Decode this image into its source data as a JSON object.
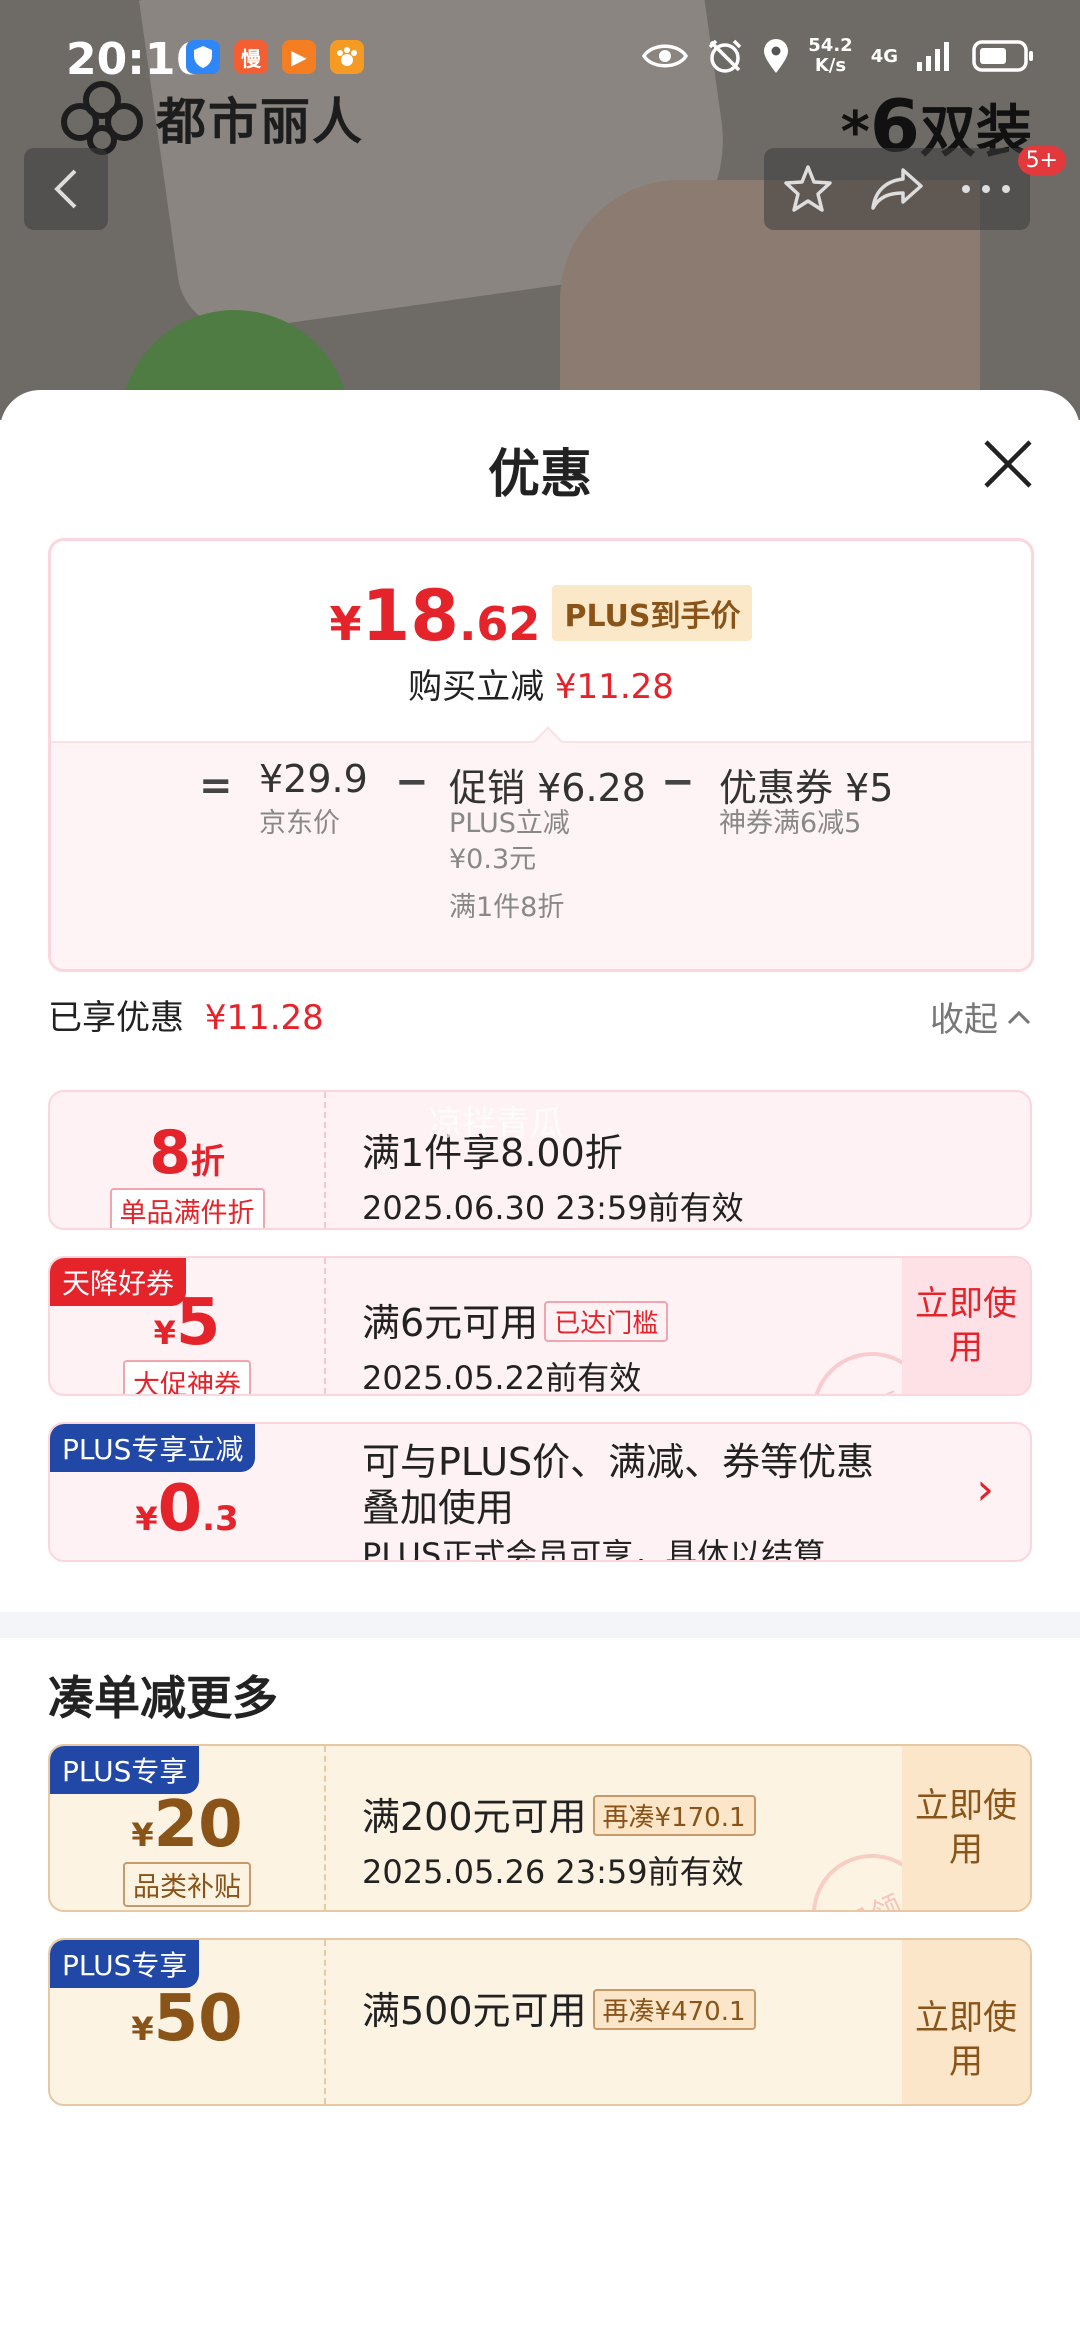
{
  "status_bar": {
    "time": "20:16",
    "speed_value": "54.2",
    "speed_unit": "K/s",
    "network": "4G",
    "apps": [
      {
        "name": "shield-app-icon",
        "label": "",
        "color": "#2f86f6"
      },
      {
        "name": "man-app-icon",
        "label": "慢",
        "color": "#f25f32"
      },
      {
        "name": "play-app-icon",
        "label": "▶",
        "color": "#f57e23"
      },
      {
        "name": "paw-app-icon",
        "label": "🐾",
        "color": "#f59a23"
      }
    ]
  },
  "product_bg": {
    "brand": "都市丽人",
    "pair_prefix": "*",
    "pair_number": "6",
    "pair_unit": "双装",
    "badge": "5+"
  },
  "sheet": {
    "title": "优惠",
    "summary": {
      "currency": "¥",
      "price_int": "18",
      "price_dec": ".62",
      "plus_label": "PLUS到手价",
      "reduce_label": "购买立减",
      "reduce_value": "¥11.28",
      "eq": "=",
      "minus": "−",
      "jd_price": "¥29.9",
      "jd_label": "京东价",
      "promo_label": "促销",
      "promo_value": "¥6.28",
      "promo_sub1": "PLUS立减",
      "promo_sub2": "¥0.3元",
      "promo_sub3": "满1件8折",
      "coupon_label": "优惠券",
      "coupon_value": "¥5",
      "coupon_sub": "神券满6减5"
    },
    "enjoyed_label": "已享优惠",
    "enjoyed_value": "¥11.28",
    "collapse_label": "收起",
    "watermark": "凉拌青瓜",
    "coupons": [
      {
        "amount": "8",
        "unit": "折",
        "tag": "单品满件折",
        "line1": "满1件享8.00折",
        "line2": "2025.06.30 23:59前有效"
      },
      {
        "corner": "天降好券",
        "currency": "¥",
        "amount": "5",
        "tag": "大促神券",
        "line1": "满6元可用",
        "threshold": "已达门槛",
        "line2": "2025.05.22前有效",
        "action": "立即使用",
        "stamp": "已领"
      },
      {
        "corner": "PLUS专享立减",
        "currency": "¥",
        "amount": "0",
        "amount_dec": ".3",
        "line1": "可与PLUS价、满减、券等优惠",
        "line1b": "叠加使用",
        "line2": "PLUS正式会员可享，具体以结算…",
        "chevron": "›"
      }
    ],
    "more_title": "凑单减更多",
    "more_coupons": [
      {
        "corner": "PLUS专享",
        "currency": "¥",
        "amount": "20",
        "tag": "品类补贴",
        "line1": "满200元可用",
        "threshold": "再凑¥170.1",
        "line2": "2025.05.26 23:59前有效",
        "action": "立即使用",
        "stamp": "已领"
      },
      {
        "corner": "PLUS专享",
        "currency": "¥",
        "amount": "50",
        "line1": "满500元可用",
        "threshold": "再凑¥470.1",
        "action": "立即使用"
      }
    ]
  },
  "colors": {
    "accent_red": "#e4232b",
    "plus_blue": "#2148a6",
    "gold_text": "#8a5317"
  }
}
